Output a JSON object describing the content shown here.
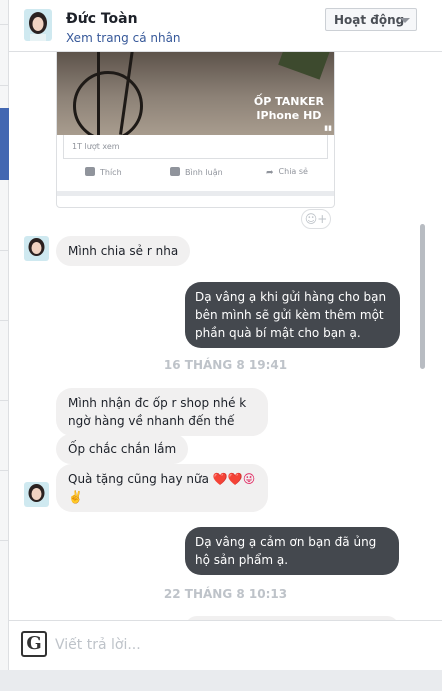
{
  "header": {
    "name": "Đức Toàn",
    "profile_link": "Xem trang cá nhân",
    "status_button": "Hoạt động"
  },
  "shared_post": {
    "video_caption_line1": "ỐP TANKER",
    "video_caption_line2": "IPhone HD",
    "views": "1T lượt xem",
    "like_label": "Thích",
    "comment_label": "Bình luận",
    "share_label": "Chia sẻ"
  },
  "messages": [
    {
      "from": "them",
      "text": "Mình chia sẻ r nha"
    },
    {
      "from": "me",
      "text": "Dạ vâng ạ khi gửi hàng cho bạn bên mình sẽ gửi kèm thêm một phần quà bí mật cho bạn ạ."
    },
    {
      "from": "them",
      "text": "Mình nhận đc ốp r shop nhé k ngờ hàng về nhanh đến thế"
    },
    {
      "from": "them",
      "text": "Ốp chắc chắn lắm"
    },
    {
      "from": "them",
      "text": "Quà tặng cũng hay nữa",
      "emoji": "❤️❤️😜",
      "emoji2": "✌️"
    },
    {
      "from": "me",
      "text": "Dạ vâng ạ cảm ơn bạn đã ủng hộ sản phẩm ạ."
    }
  ],
  "timestamps": [
    "16 THÁNG 8 19:41",
    "22 THÁNG 8 10:13"
  ],
  "composer": {
    "placeholder": "Viết trả lời...",
    "g_icon": "G"
  },
  "colors": {
    "outgoing_bubble": "#44484e",
    "incoming_bubble": "#f1f0f0",
    "link": "#365899"
  }
}
